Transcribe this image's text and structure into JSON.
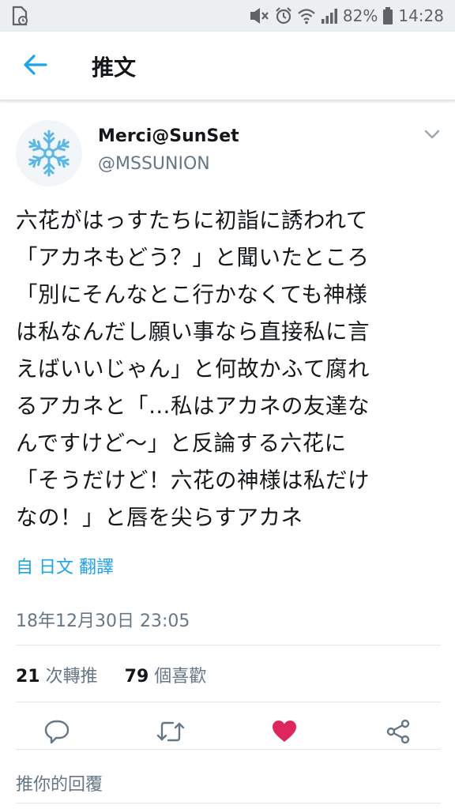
{
  "status_bar": {
    "battery_percent": "82%",
    "time": "14:28",
    "icons": [
      "sim-card-icon",
      "mute-icon",
      "alarm-icon",
      "wifi-icon",
      "signal-icon",
      "battery-icon"
    ]
  },
  "app_bar": {
    "back_icon": "arrow-left-icon",
    "title": "推文"
  },
  "tweet": {
    "author_name": "Merci@SunSet",
    "author_handle": "@MSSUNION",
    "avatar_icon": "snowflake-icon",
    "menu_icon": "chevron-down-icon",
    "text": "六花がはっすたちに初詣に誘われて\n「アカネもどう？」と聞いたところ\n「別にそんなとこ行かなくても神様\nは私なんだし願い事なら直接私に言\nえばいいじゃん」と何故かふて腐れ\nるアカネと「…私はアカネの友達な\nんですけど～」と反論する六花に\n「そうだけど！六花の神様は私だけ\nなの！」と唇を尖らすアカネ",
    "translate_label": "自 日文 翻譯",
    "timestamp": "18年12月30日 23:05",
    "retweet_count": "21",
    "retweet_label": "次轉推",
    "like_count": "79",
    "like_label": "個喜歡"
  },
  "actions": {
    "reply_icon": "reply-icon",
    "retweet_icon": "retweet-icon",
    "like_icon": "heart-icon",
    "like_color": "#e0245e",
    "share_icon": "share-icon"
  },
  "reply_prompt": "推你的回覆",
  "colors": {
    "accent": "#1da1f2",
    "secondary_text": "#657786",
    "divider": "#e1e8ed"
  }
}
